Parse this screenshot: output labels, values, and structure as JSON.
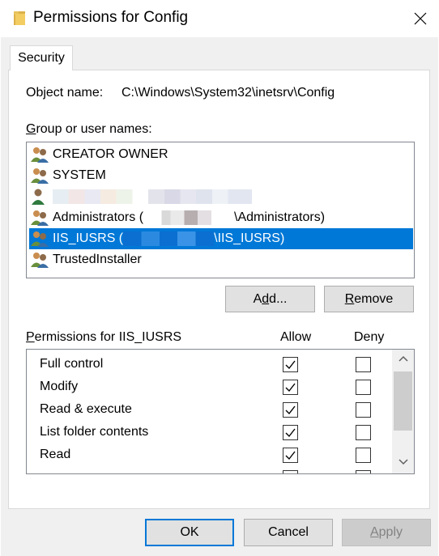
{
  "window": {
    "title": "Permissions for Config"
  },
  "tabs": [
    {
      "label": "Security"
    }
  ],
  "object": {
    "label": "Object name:",
    "value": "C:\\Windows\\System32\\inetsrv\\Config"
  },
  "groups": {
    "label_prefix": "G",
    "label_rest": "roup or user names:",
    "items": [
      {
        "name": "CREATOR OWNER",
        "icon": "users-group-icon"
      },
      {
        "name": "SYSTEM",
        "icon": "users-group-icon"
      },
      {
        "name": "",
        "icon": "single-user-icon",
        "redacted": true
      },
      {
        "name_prefix": "Administrators (",
        "name_suffix": "\\Administrators)",
        "icon": "users-group-icon"
      },
      {
        "name_prefix": "IIS_IUSRS (",
        "name_suffix": "\\IIS_IUSRS)",
        "icon": "users-group-icon",
        "selected": true
      },
      {
        "name": "TrustedInstaller",
        "icon": "users-group-icon"
      }
    ]
  },
  "buttons": {
    "add_prefix": "A",
    "add_ul": "d",
    "add_suffix": "d...",
    "remove_ul": "R",
    "remove_suffix": "emove",
    "ok": "OK",
    "cancel": "Cancel",
    "apply_ul": "A",
    "apply_suffix": "pply"
  },
  "permissions": {
    "label_ul": "P",
    "label_rest": "ermissions for IIS_IUSRS",
    "allow_header": "Allow",
    "deny_header": "Deny",
    "rows": [
      {
        "name": "Full control",
        "allow": true,
        "deny": false
      },
      {
        "name": "Modify",
        "allow": true,
        "deny": false
      },
      {
        "name": "Read & execute",
        "allow": true,
        "deny": false
      },
      {
        "name": "List folder contents",
        "allow": true,
        "deny": false
      },
      {
        "name": "Read",
        "allow": true,
        "deny": false
      }
    ]
  },
  "colors": {
    "selection": "#0078d7",
    "dialog_bg": "#f0f0f0"
  }
}
